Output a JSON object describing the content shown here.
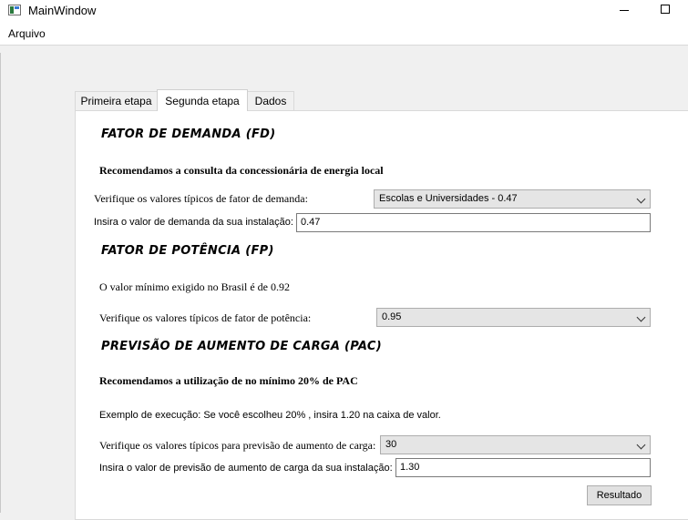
{
  "window": {
    "title": "MainWindow"
  },
  "menu": {
    "items": [
      "Arquivo"
    ]
  },
  "tabs": [
    {
      "label": "Primeira etapa",
      "selected": false
    },
    {
      "label": "Segunda etapa",
      "selected": true
    },
    {
      "label": "Dados",
      "selected": false
    }
  ],
  "fd": {
    "heading": "FATOR DE DEMANDA (FD)",
    "recommendation": "Recomendamos a consulta da concessionária de energia local",
    "typical_label": "Verifique os valores típicos de fator de demanda:",
    "typical_value": "Escolas e Universidades - 0.47",
    "input_label": "Insira o valor de demanda da sua instalação:",
    "input_value": "0.47"
  },
  "fp": {
    "heading": "FATOR DE POTÊNCIA (FP)",
    "info": "O valor mínimo exigido no Brasil é de 0.92",
    "typical_label": "Verifique os valores típicos de fator de potência:",
    "typical_value": "0.95"
  },
  "pac": {
    "heading": "PREVISÃO DE AUMENTO DE CARGA (PAC)",
    "recommendation": "Recomendamos a utilização de no mínimo 20% de PAC",
    "example": "Exemplo de execução: Se você escolheu 20% , insira 1.20 na caixa de valor.",
    "typical_label": "Verifique os valores típicos para previsão de aumento de carga:",
    "typical_value": "30",
    "input_label": "Insira o valor de previsão de aumento de carga da sua instalação:",
    "input_value": "1.30"
  },
  "result_button": "Resultado",
  "icons": {
    "window": "app-window-icon",
    "minimize": "minimize-icon",
    "maximize": "maximize-icon",
    "dropdown": "chevron-down-icon"
  }
}
